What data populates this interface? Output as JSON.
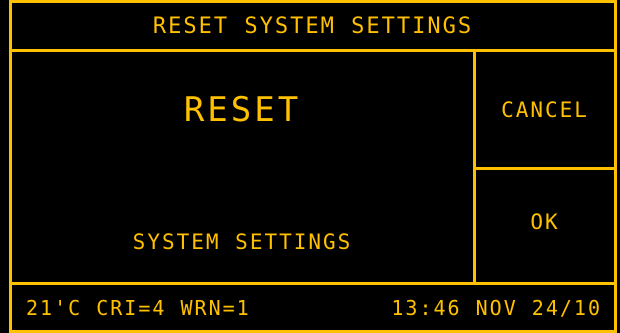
{
  "colors": {
    "background": "#000000",
    "accent": "#FFC000"
  },
  "header": {
    "title": "RESET SYSTEM SETTINGS"
  },
  "main": {
    "heading": "RESET",
    "subtext": "SYSTEM SETTINGS"
  },
  "buttons": {
    "cancel_label": "CANCEL",
    "ok_label": "OK"
  },
  "status_bar": {
    "temperature": "21'C",
    "cri": "CRI=4",
    "warnings": "WRN=1",
    "time": "13:46",
    "date": "NOV 24/10"
  }
}
